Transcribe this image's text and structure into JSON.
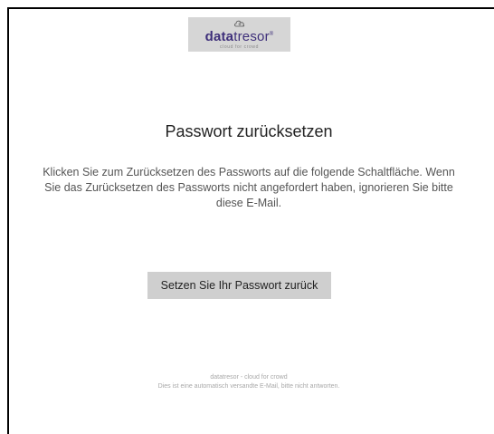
{
  "logo": {
    "brand_bold": "data",
    "brand_regular": "tresor",
    "trademark": "®",
    "tagline": "cloud for crowd",
    "icon": "cloud-icon"
  },
  "email": {
    "title": "Passwort zurücksetzen",
    "message": "Klicken Sie zum Zurücksetzen des Passworts auf die folgende Schaltfläche. Wenn Sie das Zurücksetzen des Passworts nicht angefordert haben, ignorieren Sie bitte diese E-Mail.",
    "button_label": "Setzen Sie Ihr Passwort zurück"
  },
  "footer": {
    "line1": "datatresor - cloud for crowd",
    "line2": "Dies ist eine automatisch versandte E-Mail, bitte nicht antworten."
  },
  "colors": {
    "brand": "#3e2f7a",
    "logo_background": "#d6d6d6",
    "button_background": "#cfcfcf"
  }
}
